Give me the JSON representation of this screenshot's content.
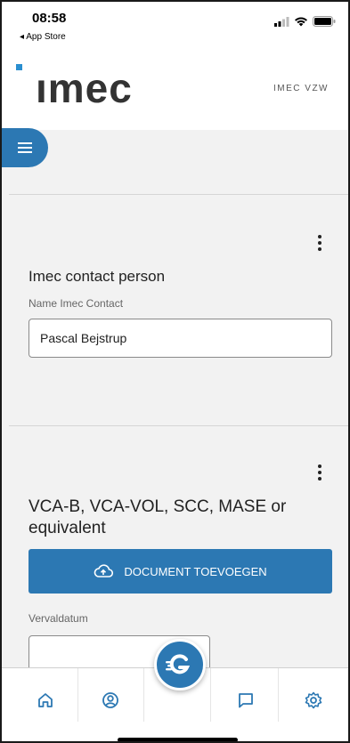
{
  "status_bar": {
    "time": "08:58",
    "back_label": "◂ App Store"
  },
  "header": {
    "logo": "ımec",
    "org": "IMEC VZW"
  },
  "icons": {
    "menu": "hamburger-icon",
    "kebab": "more-vertical-icon",
    "upload": "cloud-upload-icon",
    "fab": "g-logo-icon",
    "nav": [
      "home-icon",
      "profile-icon",
      "chat-icon",
      "settings-icon"
    ]
  },
  "contact_section": {
    "title": "Imec contact person",
    "field_label": "Name Imec Contact",
    "field_value": "Pascal Bejstrup"
  },
  "vca_section": {
    "title": "VCA-B, VCA-VOL, SCC, MASE or equivalent",
    "upload_button": "DOCUMENT TOEVOEGEN",
    "date_label": "Vervaldatum",
    "date_value": ""
  },
  "colors": {
    "accent": "#2c78b3",
    "logo_dot": "#2a8fd0"
  }
}
